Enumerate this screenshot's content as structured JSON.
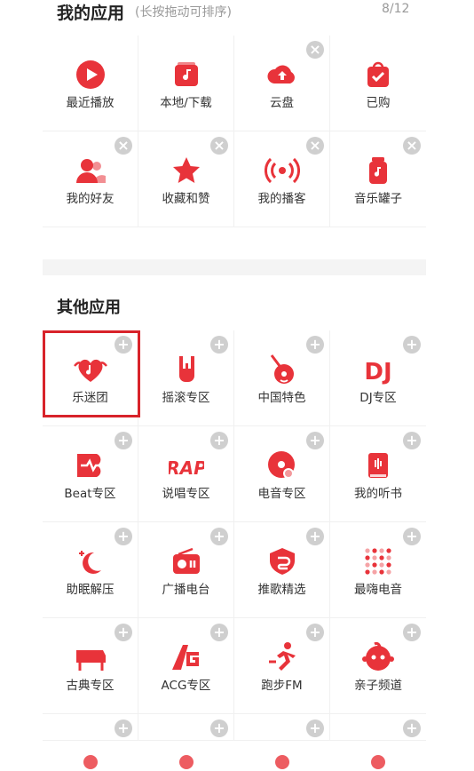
{
  "my_apps": {
    "title": "我的应用",
    "hint": "(长按拖动可排序)",
    "counter": "8/12",
    "items": [
      {
        "label": "最近播放",
        "icon": "play-icon",
        "removable": false
      },
      {
        "label": "本地/下载",
        "icon": "music-folder-icon",
        "removable": false
      },
      {
        "label": "云盘",
        "icon": "cloud-upload-icon",
        "removable": true
      },
      {
        "label": "已购",
        "icon": "purchased-bag-icon",
        "removable": false
      },
      {
        "label": "我的好友",
        "icon": "friends-icon",
        "removable": true
      },
      {
        "label": "收藏和赞",
        "icon": "star-icon",
        "removable": true
      },
      {
        "label": "我的播客",
        "icon": "podcast-icon",
        "removable": true
      },
      {
        "label": "音乐罐子",
        "icon": "music-jar-icon",
        "removable": true
      }
    ]
  },
  "other_apps": {
    "title": "其他应用",
    "items": [
      {
        "label": "乐迷团",
        "icon": "fan-club-heart-icon"
      },
      {
        "label": "摇滚专区",
        "icon": "rock-hand-icon"
      },
      {
        "label": "中国特色",
        "icon": "chinese-instrument-icon"
      },
      {
        "label": "DJ专区",
        "icon": "dj-text-icon"
      },
      {
        "label": "Beat专区",
        "icon": "beat-icon"
      },
      {
        "label": "说唱专区",
        "icon": "rap-text-icon"
      },
      {
        "label": "电音专区",
        "icon": "vinyl-icon"
      },
      {
        "label": "我的听书",
        "icon": "audiobook-icon"
      },
      {
        "label": "助眠解压",
        "icon": "moon-icon"
      },
      {
        "label": "广播电台",
        "icon": "radio-icon"
      },
      {
        "label": "推歌精选",
        "icon": "recommend-shield-icon"
      },
      {
        "label": "最嗨电音",
        "icon": "dots-grid-icon"
      },
      {
        "label": "古典专区",
        "icon": "piano-icon"
      },
      {
        "label": "ACG专区",
        "icon": "acg-icon"
      },
      {
        "label": "跑步FM",
        "icon": "runner-icon"
      },
      {
        "label": "亲子频道",
        "icon": "kid-face-icon"
      },
      {
        "label": "",
        "icon": "partial-icon"
      },
      {
        "label": "",
        "icon": "partial-icon"
      },
      {
        "label": "",
        "icon": "partial-icon"
      },
      {
        "label": "",
        "icon": "partial-icon"
      }
    ]
  },
  "badges": {
    "remove": "×",
    "add": "+"
  },
  "colors": {
    "accent": "#e8333a",
    "badge": "#cfcfcf",
    "highlight": "#d8232a"
  }
}
